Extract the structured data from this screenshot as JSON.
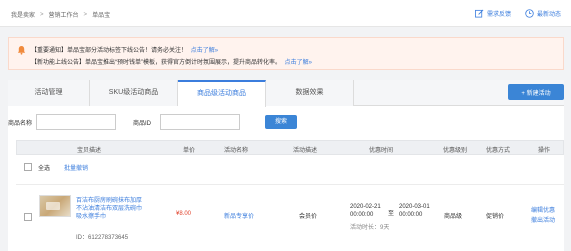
{
  "breadcrumb": {
    "items": [
      "我是卖家",
      "营销工作台",
      "单品宝"
    ],
    "separator": ">"
  },
  "top_links": {
    "feedback": "需求反馈",
    "news": "最新动态"
  },
  "notice": {
    "line1": "【重要通知】单品宝部分活动标签下线公告！请务必关注！",
    "line1_more": "点击了解»",
    "line2": "【新功能上线公告】单品宝推出“预时钱单”模板，获得官方倒计时氛围展示，提升商品转化率。",
    "line2_more": "点击了解»"
  },
  "tabs": [
    {
      "label": "活动管理",
      "active": false
    },
    {
      "label": "SKU级活动商品",
      "active": false
    },
    {
      "label": "商品级活动商品",
      "active": true
    },
    {
      "label": "数据效果",
      "active": false
    }
  ],
  "new_button": "+ 新建活动",
  "filter": {
    "name_label": "商品名称",
    "name_value": "",
    "id_label": "商品ID",
    "id_value": "",
    "search_label": "搜索"
  },
  "table": {
    "headers": [
      "宝贝描述",
      "单价",
      "活动名称",
      "活动描述",
      "优惠时间",
      "优惠级别",
      "优惠方式",
      "操作"
    ],
    "select_all": "全选",
    "bulk_edit": "批量撤销"
  },
  "rows": [
    {
      "name": "百洁布厨房刷碗抹布加厚不沾油清洁布双层洗碗巾吸水擦手巾",
      "id": "ID：612278373645",
      "price": "¥8.00",
      "activity": "新品专享价",
      "description": "会员价",
      "start": "2020-02-21",
      "start_time": "00:00:00",
      "to": "至",
      "end": "2020-03-01",
      "end_time": "00:00:00",
      "duration": "活动时长：9天",
      "level": "商品级",
      "method": "促销价",
      "op1": "编辑优惠",
      "op2": "撤出活动"
    }
  ],
  "colors": {
    "accent": "#3b7ddd",
    "button": "#3b85d6",
    "price": "#e1442e",
    "notice_bg": "#fff3ee"
  }
}
